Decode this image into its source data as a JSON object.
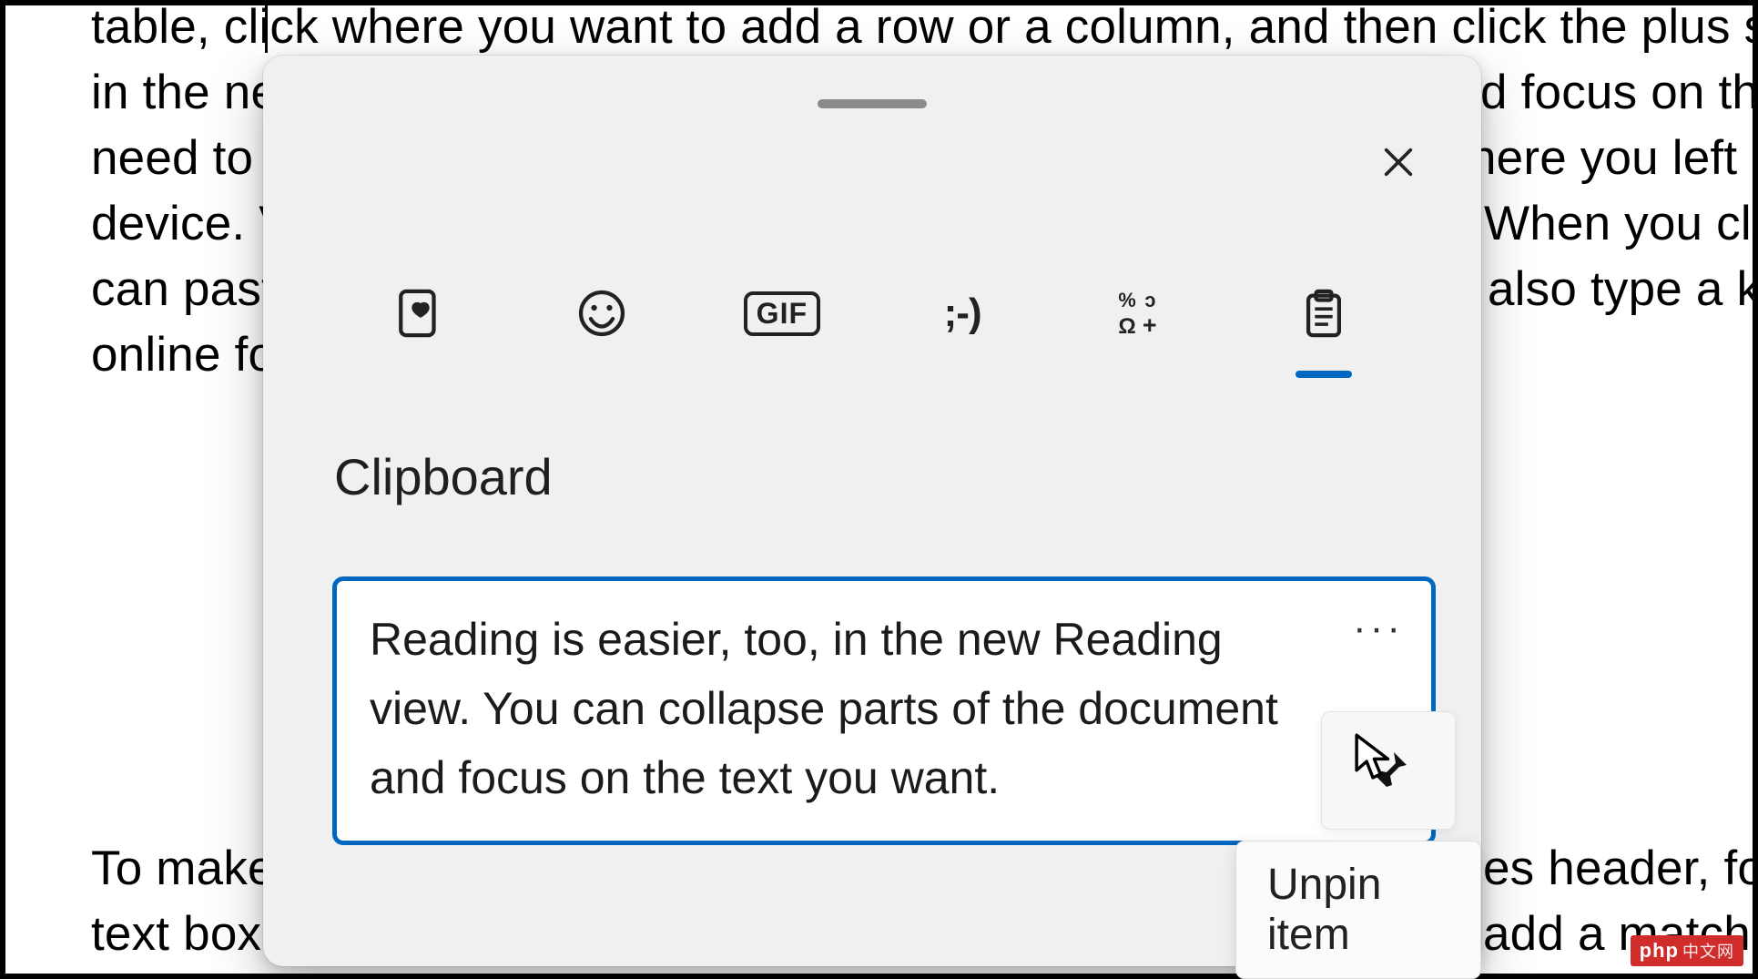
{
  "background_doc": {
    "line1": "table, click where you want to add a row or a column, and then click the plus sign. l",
    "line2_left": "in the ne",
    "line2_right": "d focus on the",
    "line3_left": "need to ",
    "line3_right": "here you left o",
    "line4_left": "device. V",
    "line4_right": "When you clic",
    "line5_left": "can past",
    "line5_right": "also type a ke",
    "line6_left": "online fo",
    "line7_left": "To make",
    "line7_right": "es header, foot",
    "line8_left": "text box",
    "line8_right": "add a matchin"
  },
  "panel": {
    "section_title": "Clipboard",
    "tabs": {
      "recent": "recent",
      "emoji": "emoji",
      "gif_label": "GIF",
      "kaomoji_label": ";-)",
      "symbols": "symbols",
      "clipboard": "clipboard"
    },
    "item": {
      "text": "Reading is easier, too, in the new Reading view. You can collapse parts of the document and focus on the text you want.",
      "more_glyph": "···"
    },
    "tooltip": "Unpin item"
  },
  "watermark": {
    "brand": "php",
    "suffix": "中文网"
  }
}
